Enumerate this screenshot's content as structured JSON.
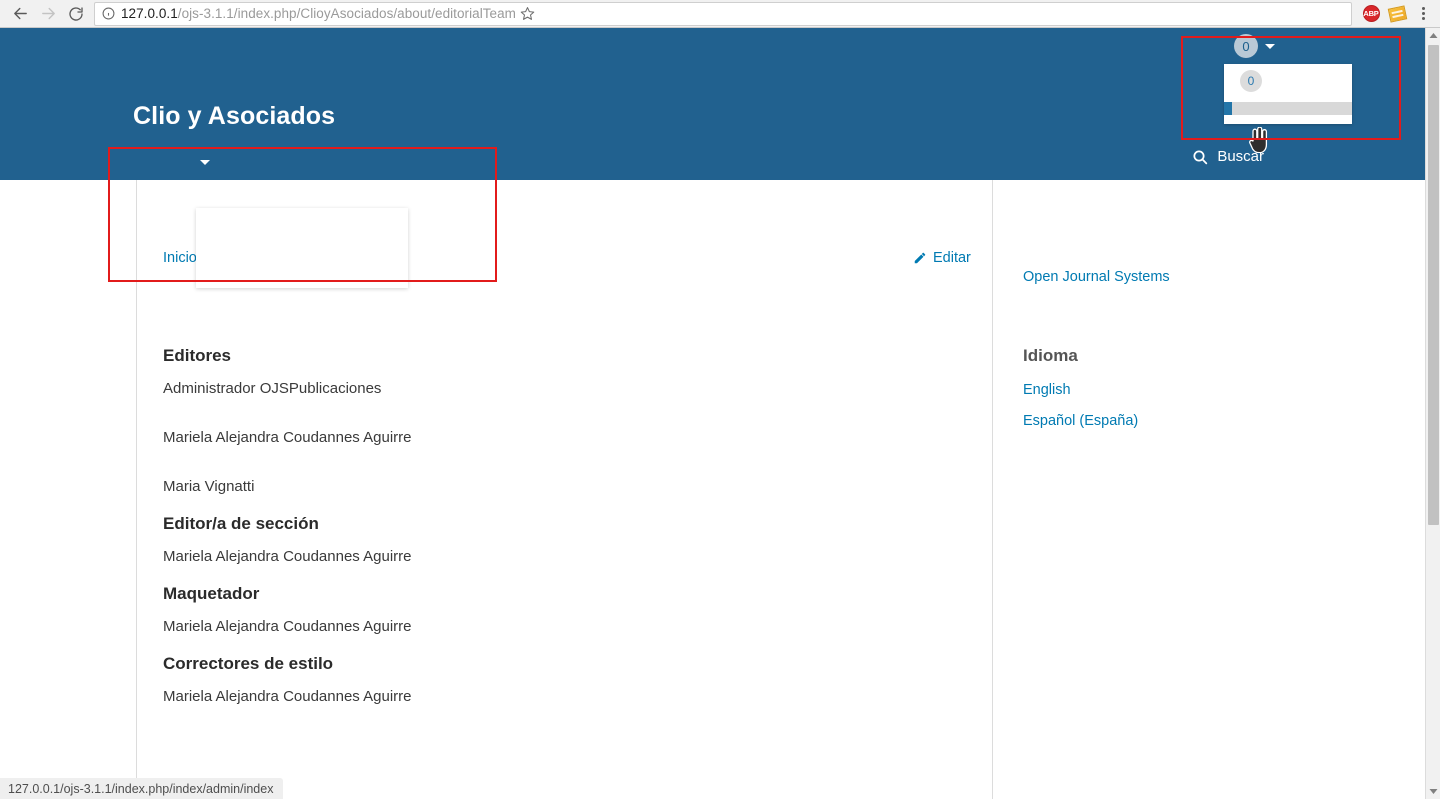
{
  "browser": {
    "back_label": "Back",
    "forward_label": "Forward",
    "reload_label": "Reload",
    "url_host": "127.0.0.1",
    "url_path": "/ojs-3.1.1/index.php/ClioyAsociados/about/editorialTeam",
    "bookmark_label": "Bookmark this page",
    "extensions": [
      {
        "name": "abp-extension",
        "label": "ABP"
      },
      {
        "name": "note-extension",
        "label": ""
      }
    ],
    "menu_label": "Customize and control Chromium",
    "status_bar_url": "127.0.0.1/ojs-3.1.1/index.php/index/admin/index"
  },
  "header": {
    "journal_title": "Clio y Asociados",
    "search_label": "Buscar",
    "user_badge": "0",
    "dropdown_badge": "0"
  },
  "page": {
    "breadcrumb": "Inicio",
    "edit_label": "Editar"
  },
  "team": {
    "groups": [
      {
        "heading": "Editores",
        "members": [
          "Administrador OJSPublicaciones",
          "Mariela Alejandra Coudannes Aguirre",
          "Maria Vignatti"
        ]
      },
      {
        "heading": "Editor/a de sección",
        "members": [
          "Mariela Alejandra Coudannes Aguirre"
        ]
      },
      {
        "heading": "Maquetador",
        "members": [
          "Mariela Alejandra Coudannes Aguirre"
        ]
      },
      {
        "heading": "Correctores de estilo",
        "members": [
          "Mariela Alejandra Coudannes Aguirre"
        ]
      }
    ]
  },
  "sidebar": {
    "ojs_link": "Open Journal Systems",
    "language_heading": "Idioma",
    "languages": [
      "English",
      "Español (España)"
    ]
  },
  "colors": {
    "header_blue": "#21618f",
    "link_blue": "#007ab2",
    "annotation_red": "#e21b1b",
    "scrollbar_thumb": "#c1c1c1"
  }
}
